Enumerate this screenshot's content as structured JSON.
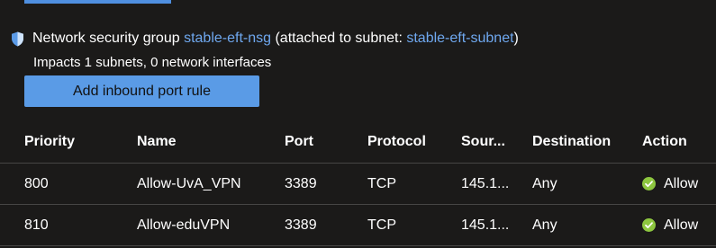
{
  "nsg": {
    "prefix": "Network security group",
    "name": "stable-eft-nsg",
    "attached_prefix": "(attached to subnet:",
    "subnet": "stable-eft-subnet",
    "attached_suffix": ")",
    "impacts": "Impacts 1 subnets, 0 network interfaces",
    "icon": "shield-icon"
  },
  "actions": {
    "add_inbound": "Add inbound port rule"
  },
  "table": {
    "columns": [
      "Priority",
      "Name",
      "Port",
      "Protocol",
      "Sour...",
      "Destination",
      "Action"
    ],
    "rows": [
      {
        "priority": "800",
        "name": "Allow-UvA_VPN",
        "port": "3389",
        "protocol": "TCP",
        "source": "145.1...",
        "destination": "Any",
        "action": "Allow"
      },
      {
        "priority": "810",
        "name": "Allow-eduVPN",
        "port": "3389",
        "protocol": "TCP",
        "source": "145.1...",
        "destination": "Any",
        "action": "Allow"
      }
    ]
  },
  "colors": {
    "background": "#1b1a19",
    "link": "#6fa8ef",
    "accent_button": "#5a9be6",
    "allow_green": "#8dc63f"
  }
}
